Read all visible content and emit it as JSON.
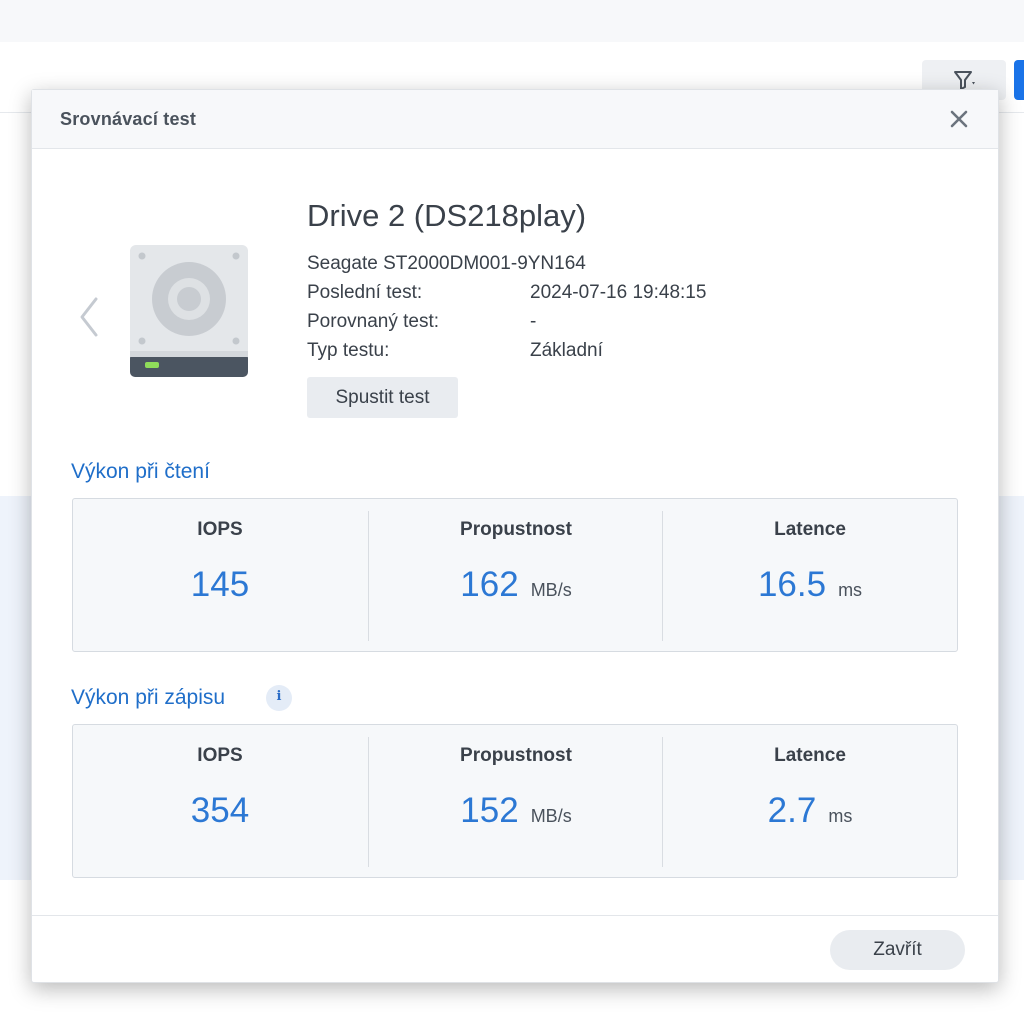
{
  "dialog": {
    "title": "Srovnávací test",
    "close_icon": "close-icon"
  },
  "drive": {
    "name": "Drive 2 (DS218play)",
    "model": "Seagate ST2000DM001-9YN164",
    "info": [
      {
        "label": "Poslední test:",
        "value": "2024-07-16 19:48:15"
      },
      {
        "label": "Porovnaný test:",
        "value": "-"
      },
      {
        "label": "Typ testu:",
        "value": "Základní"
      }
    ],
    "run_button": "Spustit test",
    "status_led_color": "#8fdc5a"
  },
  "read": {
    "title": "Výkon při čtení",
    "metrics": [
      {
        "label": "IOPS",
        "value": "145",
        "unit": ""
      },
      {
        "label": "Propustnost",
        "value": "162",
        "unit": "MB/s"
      },
      {
        "label": "Latence",
        "value": "16.5",
        "unit": "ms"
      }
    ]
  },
  "write": {
    "title": "Výkon při zápisu",
    "info_icon": "i",
    "metrics": [
      {
        "label": "IOPS",
        "value": "354",
        "unit": ""
      },
      {
        "label": "Propustnost",
        "value": "152",
        "unit": "MB/s"
      },
      {
        "label": "Latence",
        "value": "2.7",
        "unit": "ms"
      }
    ]
  },
  "footer": {
    "close_button": "Zavřít"
  },
  "colors": {
    "accent": "#2c78d4",
    "section_title": "#1f6ec9",
    "primary_button": "#1a73e8"
  }
}
